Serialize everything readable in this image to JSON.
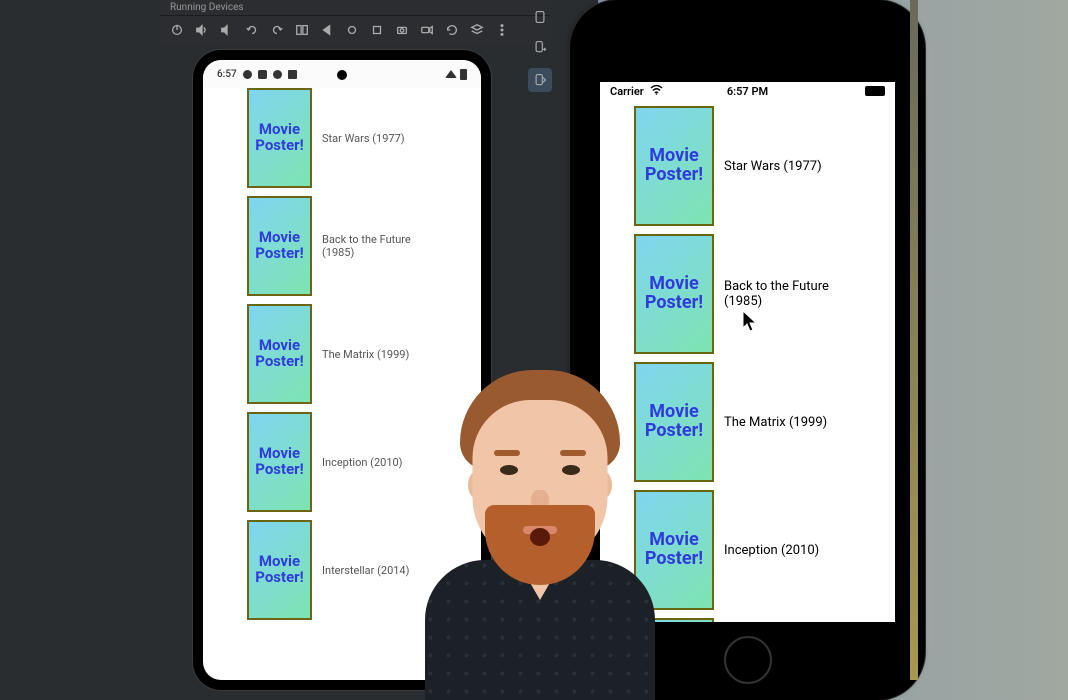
{
  "ide": {
    "tab_label": "Running Devices"
  },
  "poster": {
    "line1": "Movie",
    "line2": "Poster!"
  },
  "android": {
    "clock": "6:57",
    "movies": [
      {
        "title": "Star Wars (1977)"
      },
      {
        "title": "Back to the Future (1985)"
      },
      {
        "title": "The Matrix (1999)"
      },
      {
        "title": "Inception (2010)"
      },
      {
        "title": "Interstellar (2014)"
      }
    ]
  },
  "ios": {
    "carrier": "Carrier",
    "clock": "6:57 PM",
    "movies": [
      {
        "title": "Star Wars (1977)"
      },
      {
        "title": "Back to the Future (1985)"
      },
      {
        "title": "The Matrix (1999)"
      },
      {
        "title": "Inception (2010)"
      }
    ]
  }
}
